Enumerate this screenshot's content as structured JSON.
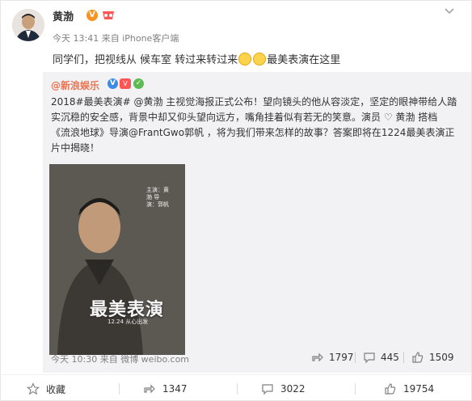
{
  "post": {
    "author": "黄渤",
    "verified_badge": "V",
    "meta": "今天 13:41 来自 iPhone客户端",
    "content_part1": "同学们，把视线从 候车室 转过来转过来",
    "content_part2": "最美表演在这里"
  },
  "repost": {
    "author": "@新浪娱乐",
    "badge_v": "V",
    "badge_vip": "V",
    "badge_c": "✓",
    "line1": "2018#最美表演# @黄渤 主视觉海报正式公布！望向镜头的他从容淡定，坚定的眼神带给人踏",
    "line2": "实沉稳的安全感，背景中却又仰头望向远方，嘴角挂着似有若无的笑意。演员 ♡ 黄渤 搭档",
    "line3": "《流浪地球》导演@FrantGwo郭帆 ，将为我们带来怎样的故事？答案即将在1224最美表演正",
    "line4": "片中揭晓！",
    "poster": {
      "title": "最美表演",
      "date": "12.24 从心出发",
      "credits": "主演：黄渤 导演：郭帆"
    },
    "meta": "今天 10:30 来自 微博 weibo.com",
    "reposts": "1797",
    "comments": "445",
    "likes": "1509"
  },
  "actions": {
    "favorite": "收藏",
    "repost": "1347",
    "comment": "3022",
    "like": "19754"
  },
  "colors": {
    "link": "#eb7350",
    "repost_bg": "#f2f2f5",
    "meta": "#808080"
  }
}
